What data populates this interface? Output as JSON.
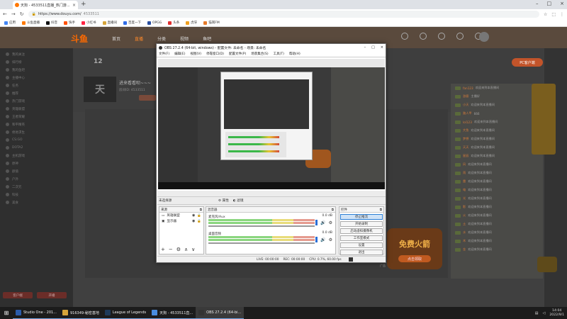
{
  "browser": {
    "tab_title": "天狗 - 4533511直播_热门游...",
    "url_scheme": "https://www.douyu.com/",
    "url_path": "4533511",
    "bookmarks": [
      "应用",
      "斗鱼直播",
      "抖音",
      "快手",
      "小红书",
      "直播间",
      "百度一下",
      "OPGG",
      "头条",
      "虎牙",
      "猫耳FM"
    ]
  },
  "douyu": {
    "logo": "斗鱼",
    "nav": [
      "首页",
      "直播",
      "分类",
      "视频",
      "鱼吧"
    ],
    "active_nav_index": 1,
    "pc_button": "PC客户端",
    "sidebar_items": [
      "我的关注",
      "排行榜",
      "我的鱼吧",
      "主播中心",
      "任务",
      "推荐",
      "热门游戏",
      "英雄联盟",
      "王者荣耀",
      "和平精英",
      "绝地求生",
      "CS:GO",
      "DOTA2",
      "主机游戏",
      "原神",
      "颜值",
      "户外",
      "二次元",
      "科技",
      "美食"
    ],
    "sidebar_buttons": [
      "客户端",
      "开播"
    ],
    "fans_count": "12",
    "streamer_title": "进来看看呗~~~",
    "streamer_id": "房间ID: 4533511",
    "streamer_avatar_text": "天",
    "chat_messages": [
      {
        "name": "fan123",
        "msg": "欢迎来到本直播间"
      },
      {
        "name": "游客",
        "msg": "主播好"
      },
      {
        "name": "小天",
        "msg": "欢迎来到本直播间"
      },
      {
        "name": "路人甲",
        "msg": "666"
      },
      {
        "name": "lol123",
        "msg": "欢迎来到本直播间"
      },
      {
        "name": "大鱼",
        "msg": "欢迎来到本直播间"
      },
      {
        "name": "梦想",
        "msg": "欢迎来到本直播间"
      },
      {
        "name": "天天",
        "msg": "欢迎来到本直播间"
      },
      {
        "name": "星辰",
        "msg": "欢迎来到本直播间"
      },
      {
        "name": "风",
        "msg": "欢迎来到本直播间"
      },
      {
        "name": "雨",
        "msg": "欢迎来到本直播间"
      },
      {
        "name": "雷",
        "msg": "欢迎来到本直播间"
      },
      {
        "name": "电",
        "msg": "欢迎来到本直播间"
      },
      {
        "name": "光",
        "msg": "欢迎来到本直播间"
      },
      {
        "name": "影",
        "msg": "欢迎来到本直播间"
      },
      {
        "name": "火",
        "msg": "欢迎来到本直播间"
      },
      {
        "name": "土",
        "msg": "欢迎来到本直播间"
      },
      {
        "name": "水",
        "msg": "欢迎来到本直播间"
      },
      {
        "name": "木",
        "msg": "欢迎来到本直播间"
      },
      {
        "name": "金",
        "msg": "欢迎来到本直播间"
      }
    ],
    "rocket_ad_title": "免费火箭",
    "rocket_ad_button": "点击领取",
    "ad_label": "广告"
  },
  "obs": {
    "title": "OBS 27.2.4 (64-bit, windows) - 配置文件: 未命名 - 场景: 未命名",
    "menu": [
      "文件(F)",
      "编辑(E)",
      "视图(V)",
      "停靠窗口(D)",
      "配置文件(P)",
      "场景集合(S)",
      "工具(T)",
      "帮助(H)"
    ],
    "scene_label": "未选择源",
    "scene_buttons": [
      "属性",
      "滤镜"
    ],
    "sources_title": "来源",
    "sources": [
      "英雄联盟",
      "显示器"
    ],
    "mixer_title": "混音器",
    "mixer": [
      {
        "name": "麦克风/Aux",
        "db": "0.0 dB"
      },
      {
        "name": "桌面音频",
        "db": "0.0 dB"
      }
    ],
    "controls_title": "控件",
    "controls": [
      "停止推流",
      "开始录制",
      "启动虚拟摄像机",
      "工作室模式",
      "设置",
      "退出"
    ],
    "active_control_index": 0,
    "status": {
      "live": "LIVE: 00:00:00",
      "rec": "REC: 00:00:00",
      "cpu": "CPU: 0.7%, 60.00 fps"
    }
  },
  "taskbar": {
    "items": [
      {
        "label": "Studio One - 201...",
        "color": "#2b5cab"
      },
      {
        "label": "916349-秘密基地",
        "color": "#d6a43a"
      },
      {
        "label": "League of Legends",
        "color": "#1e3a5a"
      },
      {
        "label": "天狗 - 4533511直...",
        "color": "#4a8de0"
      },
      {
        "label": "OBS 27.2.4 (64-bi...",
        "color": "#333333"
      }
    ],
    "active_index": 4,
    "time": "14:04",
    "date": "2022/9/1"
  }
}
